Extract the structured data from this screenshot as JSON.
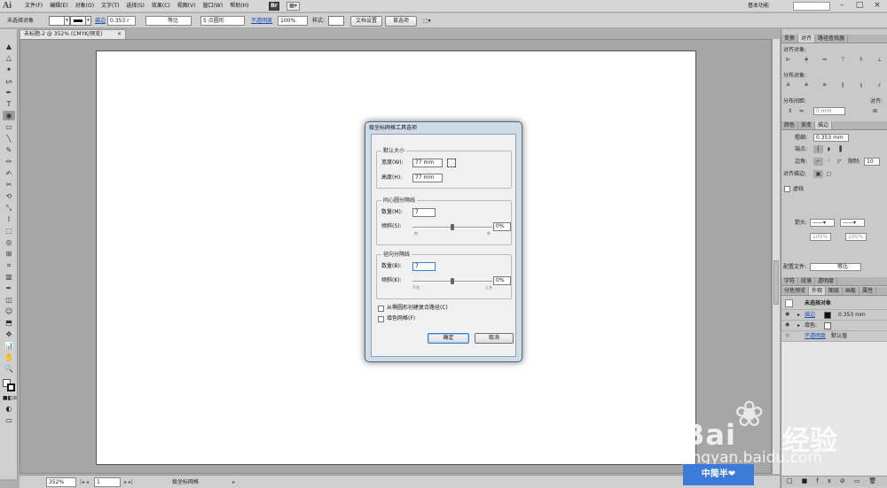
{
  "app": {
    "logo": "Ai",
    "menus": [
      "文件(F)",
      "编辑(E)",
      "对象(O)",
      "文字(T)",
      "选择(S)",
      "效果(C)",
      "视图(V)",
      "窗口(W)",
      "帮助(H)"
    ],
    "bridge_label": "Br",
    "workspace": "基本功能",
    "win_min": "–",
    "win_max": "□",
    "win_close": "×"
  },
  "control_bar": {
    "selection": "未选择对象",
    "stroke_link": "描边",
    "stroke_weight": "0.353 r",
    "profile": "等比",
    "brush": "5 点圆形",
    "opacity_link": "不透明度",
    "opacity": "100%",
    "style_label": "样式:",
    "doc_setup_btn": "文档设置",
    "prefs_btn": "首选项"
  },
  "document": {
    "tab_title": "未标题-2 @ 352% (CMYK/预览)",
    "tab_close": "×",
    "zoom": "352%",
    "artboard_num": "1",
    "status_tool": "极坐标网格"
  },
  "toolbar": {
    "tools": [
      "▲",
      "△",
      "✦",
      "ᔕ",
      "✒",
      "T",
      "╲",
      "▭",
      "✎",
      "✏",
      "◉",
      "⟲",
      "⤡",
      "⬚",
      "✂",
      "☺",
      "⊞",
      "▥",
      "◫",
      "⬒",
      "✍",
      "◎",
      "⟟",
      "⌗",
      "📊",
      "✥",
      "🔍",
      "✋"
    ]
  },
  "panels": {
    "align": {
      "tabs": [
        "变换",
        "对齐",
        "路径查找器"
      ],
      "align_objects": "对齐对象:",
      "distribute_objects": "分布对象:",
      "distribute_spacing": "分布间距:",
      "align_to": "对齐:",
      "spacing_value": "0 mm"
    },
    "stroke": {
      "tabs": [
        "颜色",
        "渐变",
        "描边"
      ],
      "weight_label": "粗细:",
      "weight_value": "0.353 mm",
      "cap_label": "端点:",
      "corner_label": "边角:",
      "limit_label": "限制:",
      "limit_value": "10",
      "align_stroke_label": "对齐描边:",
      "dashed_label": "虚线",
      "arrows_label": "箭头:",
      "scale_a": "100%",
      "scale_b": "100%",
      "profile_label": "配置文件:",
      "profile_value": "等比"
    },
    "char": {
      "tabs": [
        "字符",
        "段落",
        "透明度"
      ]
    },
    "appearance": {
      "tabs": [
        "分色预览",
        "外观",
        "图层",
        "画板",
        "属性"
      ],
      "title": "未选择对象",
      "stroke_link": "描边",
      "stroke_value": "0.353 mm",
      "fill_label": "填色:",
      "opacity_link": "不透明度",
      "opacity_value": "默认值"
    }
  },
  "dialog": {
    "title": "极坐标网格工具选项",
    "default_size": {
      "legend": "默认大小",
      "width_label": "宽度(W):",
      "width_value": "77 mm",
      "height_label": "高度(H):",
      "height_value": "77 mm"
    },
    "concentric": {
      "legend": "同心圆分隔线",
      "count_label": "数量(M):",
      "count_value": "7",
      "skew_label": "倾斜(S):",
      "skew_value": "0%",
      "tick_left": "内",
      "tick_right": "外"
    },
    "radial": {
      "legend": "径向分隔线",
      "count_label": "数量(B):",
      "count_value": "7",
      "skew_label": "倾斜(K):",
      "skew_value": "0%",
      "tick_left": "下方",
      "tick_right": "上方"
    },
    "compound_path_label": "从椭圆形创建复合路径(C)",
    "fill_grid_label": "填色网格(F)",
    "ok_label": "确定",
    "cancel_label": "取消"
  },
  "watermark": {
    "brand_latin": "Bai",
    "brand_cn": "经验",
    "url": "jingyan.baidu.com",
    "badge": "中简半❤"
  }
}
